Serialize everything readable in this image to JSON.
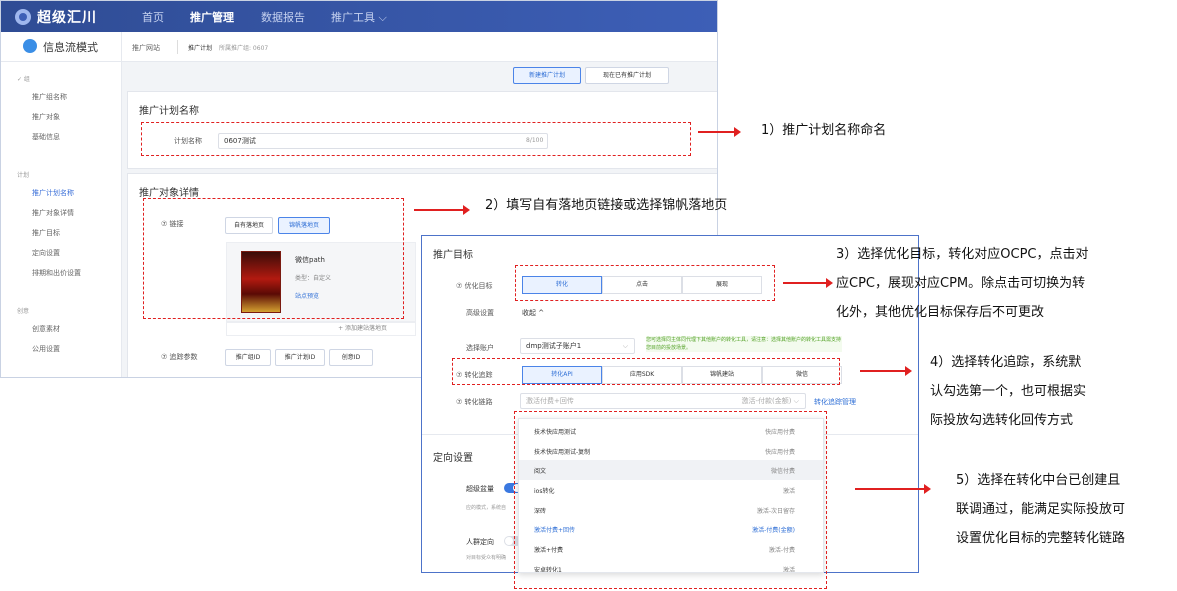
{
  "app": {
    "logo": "超级汇川",
    "nav": [
      "首页",
      "推广管理",
      "数据报告",
      "推广工具 ⌵"
    ],
    "mode": "信息流模式",
    "sidebar": {
      "group1": "✓ 组",
      "group1_items": [
        "推广组名称",
        "推广对象",
        "基础信息"
      ],
      "group2": "计划",
      "group2_items": [
        "推广计划名称",
        "推广对象详情",
        "推广目标",
        "定向设置",
        "排期和出价设置"
      ],
      "group3": "创意",
      "group3_items": [
        "创意素材",
        "公用设置"
      ]
    },
    "breadcrumb": {
      "a": "推广网站",
      "b": "推广计划",
      "c": "所属推广组: 0607"
    },
    "plan_buttons": {
      "new": "新建推广计划",
      "existing": "现在已有推广计划"
    },
    "plan_name": {
      "title": "推广计划名称",
      "label": "计划名称",
      "value": "0607测试",
      "count": "8/100"
    },
    "target": {
      "title": "推广对象详情",
      "link_label": "⑦ 链接",
      "tab_own": "自有落地页",
      "tab_jinfan": "锦帆落地页",
      "card_name": "微信path",
      "card_type": "类型：自定义",
      "card_link": "站点预览",
      "add_link": "+ 添加建站落地页",
      "track_label": "⑦ 追踪参数",
      "track_btns": [
        "推广组ID",
        "推广计划ID",
        "创意ID"
      ]
    }
  },
  "panel": {
    "title": "推广目标",
    "goal_label": "⑦ 优化目标",
    "goals": [
      "转化",
      "点击",
      "展现"
    ],
    "adv_label": "高级设置",
    "adv_value": "收起 ^",
    "account_label": "选择账户",
    "account_value": "dmp测试子账户1",
    "account_tip": "您可选择同主体同代理下其他账户的转化工具，请注意：选择其他账户的转化工具需支持您目前的投放场景。",
    "track_label": "⑦ 转化追踪",
    "tracks": [
      "转化API",
      "应用SDK",
      "锦帆建站",
      "微信"
    ],
    "chain_label": "⑦ 转化链路",
    "chain_value": "激活付费+回传",
    "chain_value_right": "激活-付款(金额) ⌵",
    "chain_manage": "转化追踪管理",
    "section2": "定向设置",
    "super_label": "超级盆量",
    "super_desc": "应的模式，系统自",
    "crowd_label": "人群定向",
    "crowd_desc": "对目标受众有明确"
  },
  "dropdown": [
    {
      "l": "技术快应用测试",
      "r": "快应用付费"
    },
    {
      "l": "技术快应用测试-复制",
      "r": "快应用付费"
    },
    {
      "l": "阅文",
      "r": "微信付费"
    },
    {
      "l": "ios转化",
      "r": "激活"
    },
    {
      "l": "深砖",
      "r": "激活-次日留存"
    },
    {
      "l": "激活付费+回传",
      "r": "激活-付费(金额)"
    },
    {
      "l": "激活+付费",
      "r": "激活-付费"
    },
    {
      "l": "安卓转化1",
      "r": "激活"
    }
  ],
  "notes": {
    "n1": "1）推广计划名称命名",
    "n2": "2）填写自有落地页链接或选择锦帆落地页",
    "n3a": "3）选择优化目标，转化对应OCPC，点击对",
    "n3b": "应CPC，展现对应CPM。除点击可切换为转",
    "n3c": "化外，其他优化目标保存后不可更改",
    "n4a": "4）选择转化追踪，系统默",
    "n4b": "认勾选第一个，也可根据实",
    "n4c": "际投放勾选转化回传方式",
    "n5a": "5）选择在转化中台已创建且",
    "n5b": "联调通过，能满足实际投放可",
    "n5c": "设置优化目标的完整转化链路"
  },
  "colors": {
    "accent": "#3a6fd8",
    "annotation": "#e02020",
    "topbar": "#2f4c94"
  }
}
